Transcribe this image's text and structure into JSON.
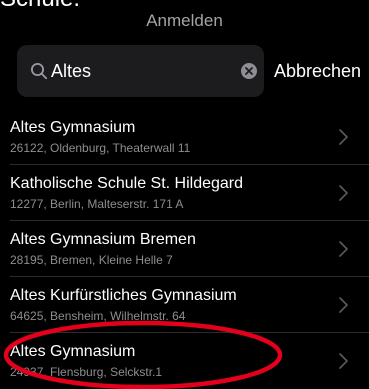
{
  "top_fragment": "Schule.",
  "header": {
    "title": "Anmelden"
  },
  "search": {
    "icon": "search-icon",
    "value": "Altes",
    "clear_icon": "clear-icon",
    "cancel_label": "Abbrechen"
  },
  "results": [
    {
      "name": "Altes Gymnasium",
      "address": "26122, Oldenburg, Theaterwall 11"
    },
    {
      "name": "Katholische Schule St. Hildegard",
      "address": "12277, Berlin, Malteserstr. 171 A"
    },
    {
      "name": "Altes Gymnasium Bremen",
      "address": "28195, Bremen, Kleine Helle 7"
    },
    {
      "name": "Altes Kurfürstliches Gymnasium",
      "address": "64625, Bensheim, Wilhelmstr. 64"
    },
    {
      "name": "Altes Gymnasium",
      "address": "24937, Flensburg, Selckstr.1"
    }
  ],
  "colors": {
    "background": "#000000",
    "search_field": "#1c1c1e",
    "secondary_text": "#8d8d93",
    "chevron": "#5a5a5e",
    "highlight_annotation": "#e3001b"
  }
}
